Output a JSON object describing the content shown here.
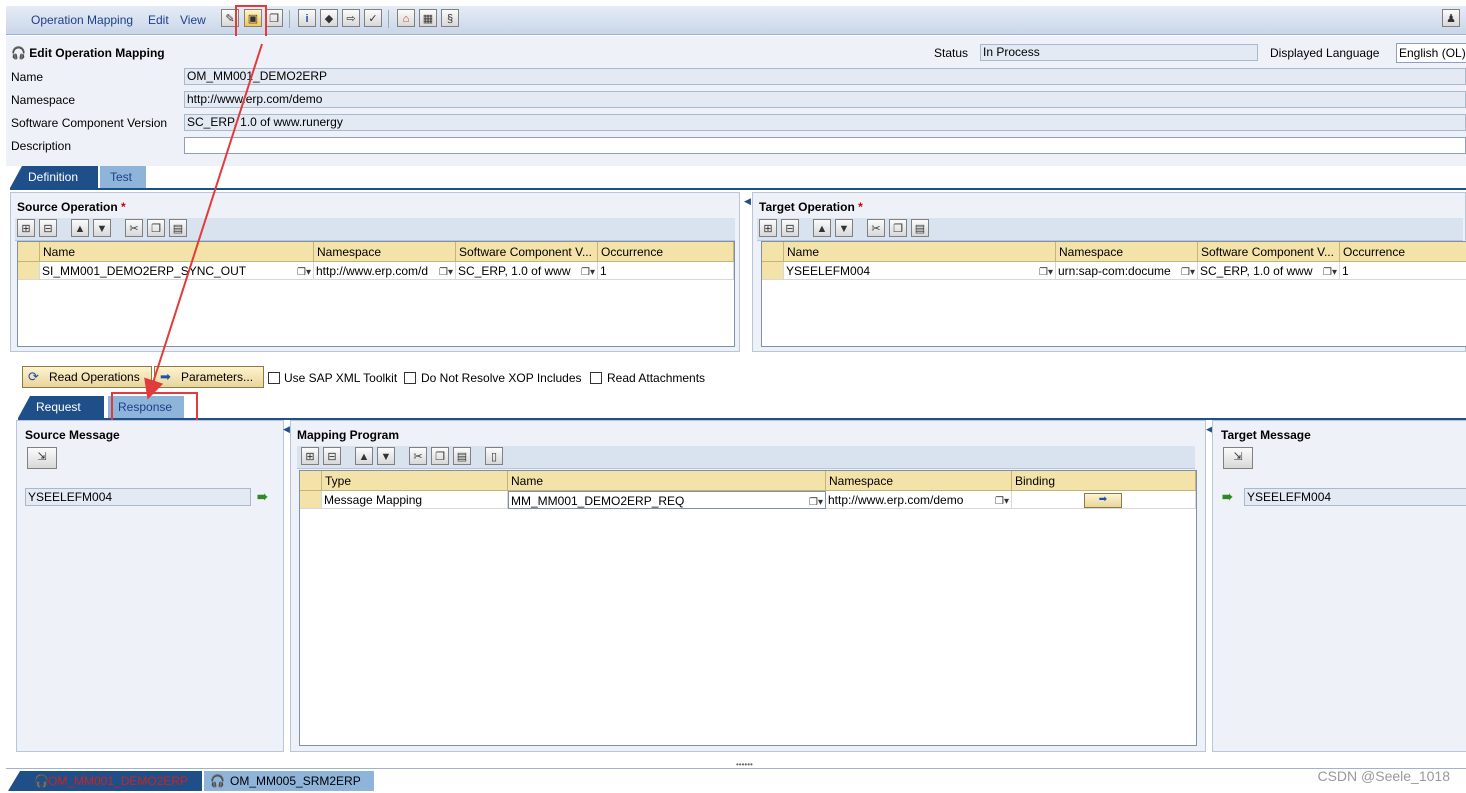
{
  "menu": {
    "items": [
      "Operation Mapping",
      "Edit",
      "View"
    ]
  },
  "form": {
    "title": "Edit Operation Mapping",
    "status_label": "Status",
    "status_value": "In Process",
    "language_label": "Displayed Language",
    "language_value": "English (OL)",
    "name_label": "Name",
    "name_value": "OM_MM001_DEMO2ERP",
    "namespace_label": "Namespace",
    "namespace_value": "http://www.erp.com/demo",
    "swcv_label": "Software Component Version",
    "swcv_value": "SC_ERP, 1.0 of www.runergy",
    "description_label": "Description",
    "description_value": ""
  },
  "main_tabs": [
    "Definition",
    "Test"
  ],
  "source_operation": {
    "title": "Source Operation",
    "required_mark": "*",
    "columns": [
      "Name",
      "Namespace",
      "Software Component V...",
      "Occurrence"
    ],
    "rows": [
      [
        "SI_MM001_DEMO2ERP_SYNC_OUT",
        "http://www.erp.com/d",
        "SC_ERP, 1.0 of www",
        "1"
      ]
    ]
  },
  "target_operation": {
    "title": "Target Operation",
    "required_mark": "*",
    "columns": [
      "Name",
      "Namespace",
      "Software Component V...",
      "Occurrence"
    ],
    "rows": [
      [
        "YSEELEFM004",
        "urn:sap-com:docume",
        "SC_ERP, 1.0 of www",
        "1"
      ]
    ]
  },
  "actions": {
    "read_operations": "Read Operations",
    "parameters": "Parameters...",
    "use_sap_xml_toolkit": "Use SAP XML Toolkit",
    "do_not_resolve_xop": "Do Not Resolve XOP Includes",
    "read_attachments": "Read Attachments"
  },
  "sub_tabs": [
    "Request",
    "Response"
  ],
  "source_message": {
    "title": "Source Message",
    "value": "YSEELEFM004"
  },
  "mapping_program": {
    "title": "Mapping Program",
    "columns": [
      "Type",
      "Name",
      "Namespace",
      "Binding"
    ],
    "rows": [
      [
        "Message Mapping",
        "MM_MM001_DEMO2ERP_REQ",
        "http://www.erp.com/demo",
        ""
      ]
    ]
  },
  "target_message": {
    "title": "Target Message",
    "value": "YSEELEFM004"
  },
  "bottom_tabs": [
    "OM_MM001_DEMO2ERP",
    "OM_MM005_SRM2ERP"
  ],
  "watermark": "CSDN @Seele_1018",
  "colors": {
    "accent_tab": "#1e4f88",
    "header_cell": "#f4e3a8",
    "annotation_red": "#e23b3b"
  }
}
